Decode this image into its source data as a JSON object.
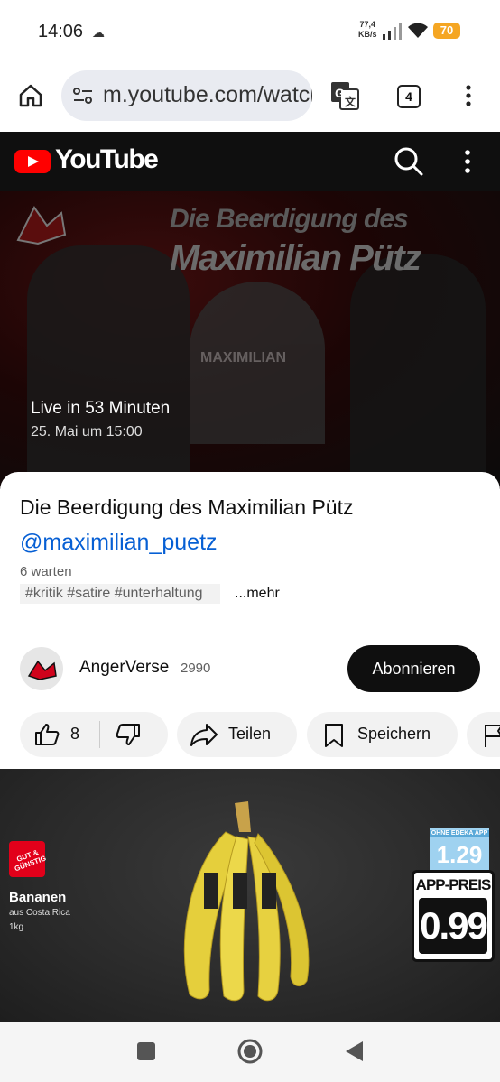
{
  "status_bar": {
    "time": "14:06",
    "net_speed_value": "77,4",
    "net_speed_unit": "KB/s",
    "battery": "70"
  },
  "browser": {
    "url": "m.youtube.com/watch",
    "tab_count": "4"
  },
  "youtube_header": {
    "brand": "YouTube"
  },
  "video": {
    "thumbnail_title_line1": "Die Beerdigung des",
    "thumbnail_title_line2": "Maximilian Pütz",
    "gravestone_text": "MAXIMILIAN",
    "live_text": "Live in 53 Minuten",
    "scheduled_date": "25. Mai um 15:00"
  },
  "details": {
    "title": "Die Beerdigung des Maximilian Pütz",
    "handle": "@maximilian_puetz",
    "waiting": "6 warten",
    "tags": "#kritik #satire #unterhaltung",
    "more": "...mehr"
  },
  "channel": {
    "name": "AngerVerse",
    "subscribers": "2990",
    "subscribe_label": "Abonnieren"
  },
  "actions": {
    "like_count": "8",
    "share_label": "Teilen",
    "save_label": "Speichern"
  },
  "ad": {
    "badge": "GUT & GÜNSTIG",
    "product": "Bananen",
    "origin": "aus Costa Rica",
    "weight": "1kg",
    "regular_label": "OHNE EDEKA APP",
    "regular_price": "1.29",
    "app_label": "APP-PREIS",
    "app_price": "0.99"
  },
  "colors": {
    "youtube_red": "#ff0000",
    "link_blue": "#065fd4",
    "battery_orange": "#f5a623",
    "edeka_red": "#e2001a"
  }
}
